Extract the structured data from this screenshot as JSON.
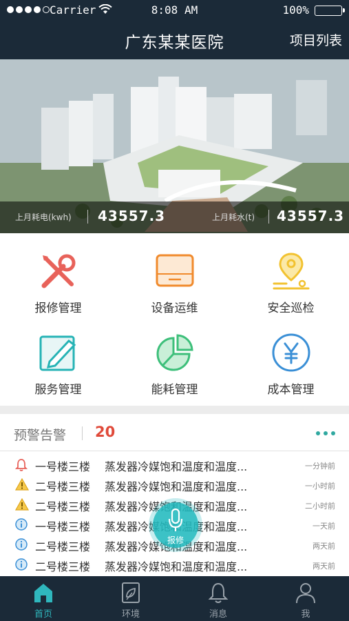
{
  "status_bar": {
    "carrier": "Carrier",
    "time": "8:08 AM",
    "battery": "100%"
  },
  "header": {
    "title": "广东某某医院",
    "action": "项目列表"
  },
  "hero": {
    "electric_label": "上月耗电(kwh)",
    "electric_value": "43557.3",
    "water_label": "上月耗水(t)",
    "water_value": "43557.3"
  },
  "menu": [
    {
      "label": "报修管理",
      "icon": "wrench-pencil-icon",
      "color": "#e8625a"
    },
    {
      "label": "设备运维",
      "icon": "device-box-icon",
      "color": "#f08a2c"
    },
    {
      "label": "安全巡检",
      "icon": "location-pin-icon",
      "color": "#f2c230"
    },
    {
      "label": "服务管理",
      "icon": "edit-pencil-icon",
      "color": "#26b3b5"
    },
    {
      "label": "能耗管理",
      "icon": "pie-chart-icon",
      "color": "#3dbf7a"
    },
    {
      "label": "成本管理",
      "icon": "yen-circle-icon",
      "color": "#3a8fd6"
    }
  ],
  "alerts": {
    "title": "预警告警",
    "count": "20",
    "items": [
      {
        "level": "bell",
        "location": "一号楼三楼",
        "message": "蒸发器冷媒饱和温度和温度...",
        "time": "一分钟前"
      },
      {
        "level": "warning",
        "location": "二号楼三楼",
        "message": "蒸发器冷媒饱和温度和温度...",
        "time": "一小时前"
      },
      {
        "level": "warning",
        "location": "二号楼三楼",
        "message": "蒸发器冷媒饱和温度和温度...",
        "time": "二小时前"
      },
      {
        "level": "info",
        "location": "一号楼三楼",
        "message": "蒸发器冷媒饱和温度和温度...",
        "time": "一天前"
      },
      {
        "level": "info",
        "location": "二号楼三楼",
        "message": "蒸发器冷媒饱和温度和温度...",
        "time": "两天前"
      },
      {
        "level": "info",
        "location": "二号楼三楼",
        "message": "蒸发器冷媒饱和温度和温度...",
        "time": "两天前"
      }
    ]
  },
  "fab": {
    "label": "报修"
  },
  "tabs": [
    {
      "label": "首页",
      "icon": "home-icon"
    },
    {
      "label": "环境",
      "icon": "environment-icon"
    },
    {
      "label": "消息",
      "icon": "bell-icon"
    },
    {
      "label": "我",
      "icon": "user-icon"
    }
  ],
  "colors": {
    "header_bg": "#1b2a38",
    "accent": "#2fb7bd",
    "alert_count": "#e04a3a"
  }
}
